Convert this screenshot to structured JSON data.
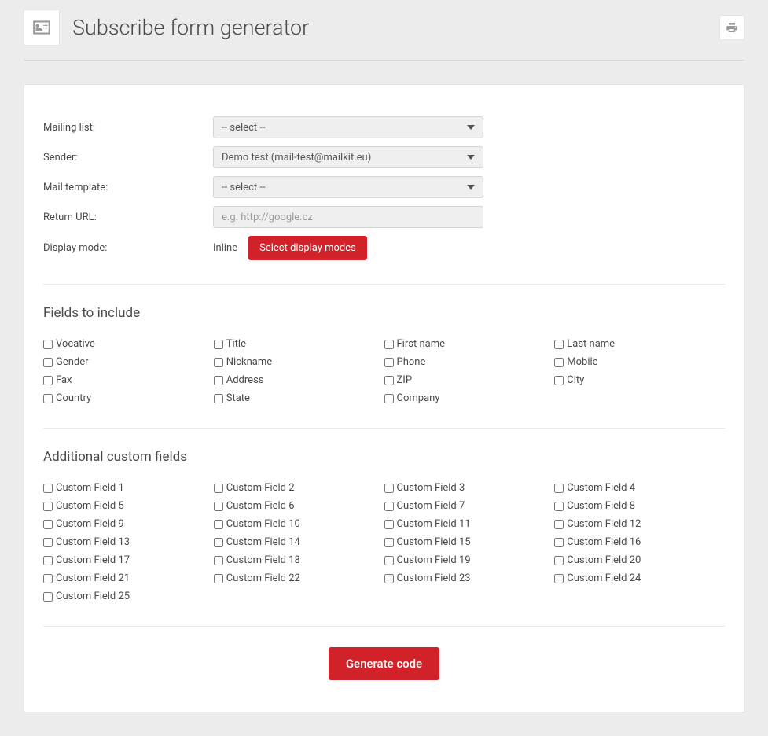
{
  "header": {
    "title": "Subscribe form generator"
  },
  "form": {
    "mailing_list": {
      "label": "Mailing list:",
      "value": "-- select --"
    },
    "sender": {
      "label": "Sender:",
      "value": "Demo test (mail-test@mailkit.eu)"
    },
    "mail_template": {
      "label": "Mail template:",
      "value": "-- select --"
    },
    "return_url": {
      "label": "Return URL:",
      "placeholder": "e.g. http://google.cz"
    },
    "display_mode": {
      "label": "Display mode:",
      "inline": "Inline",
      "button": "Select display modes"
    }
  },
  "fields": {
    "title": "Fields to include",
    "items": [
      "Vocative",
      "Title",
      "First name",
      "Last name",
      "Gender",
      "Nickname",
      "Phone",
      "Mobile",
      "Fax",
      "Address",
      "ZIP",
      "City",
      "Country",
      "State",
      "Company"
    ]
  },
  "custom": {
    "title": "Additional custom fields",
    "items": [
      "Custom Field 1",
      "Custom Field 2",
      "Custom Field 3",
      "Custom Field 4",
      "Custom Field 5",
      "Custom Field 6",
      "Custom Field 7",
      "Custom Field 8",
      "Custom Field 9",
      "Custom Field 10",
      "Custom Field 11",
      "Custom Field 12",
      "Custom Field 13",
      "Custom Field 14",
      "Custom Field 15",
      "Custom Field 16",
      "Custom Field 17",
      "Custom Field 18",
      "Custom Field 19",
      "Custom Field 20",
      "Custom Field 21",
      "Custom Field 22",
      "Custom Field 23",
      "Custom Field 24",
      "Custom Field 25"
    ]
  },
  "buttons": {
    "generate": "Generate code"
  }
}
